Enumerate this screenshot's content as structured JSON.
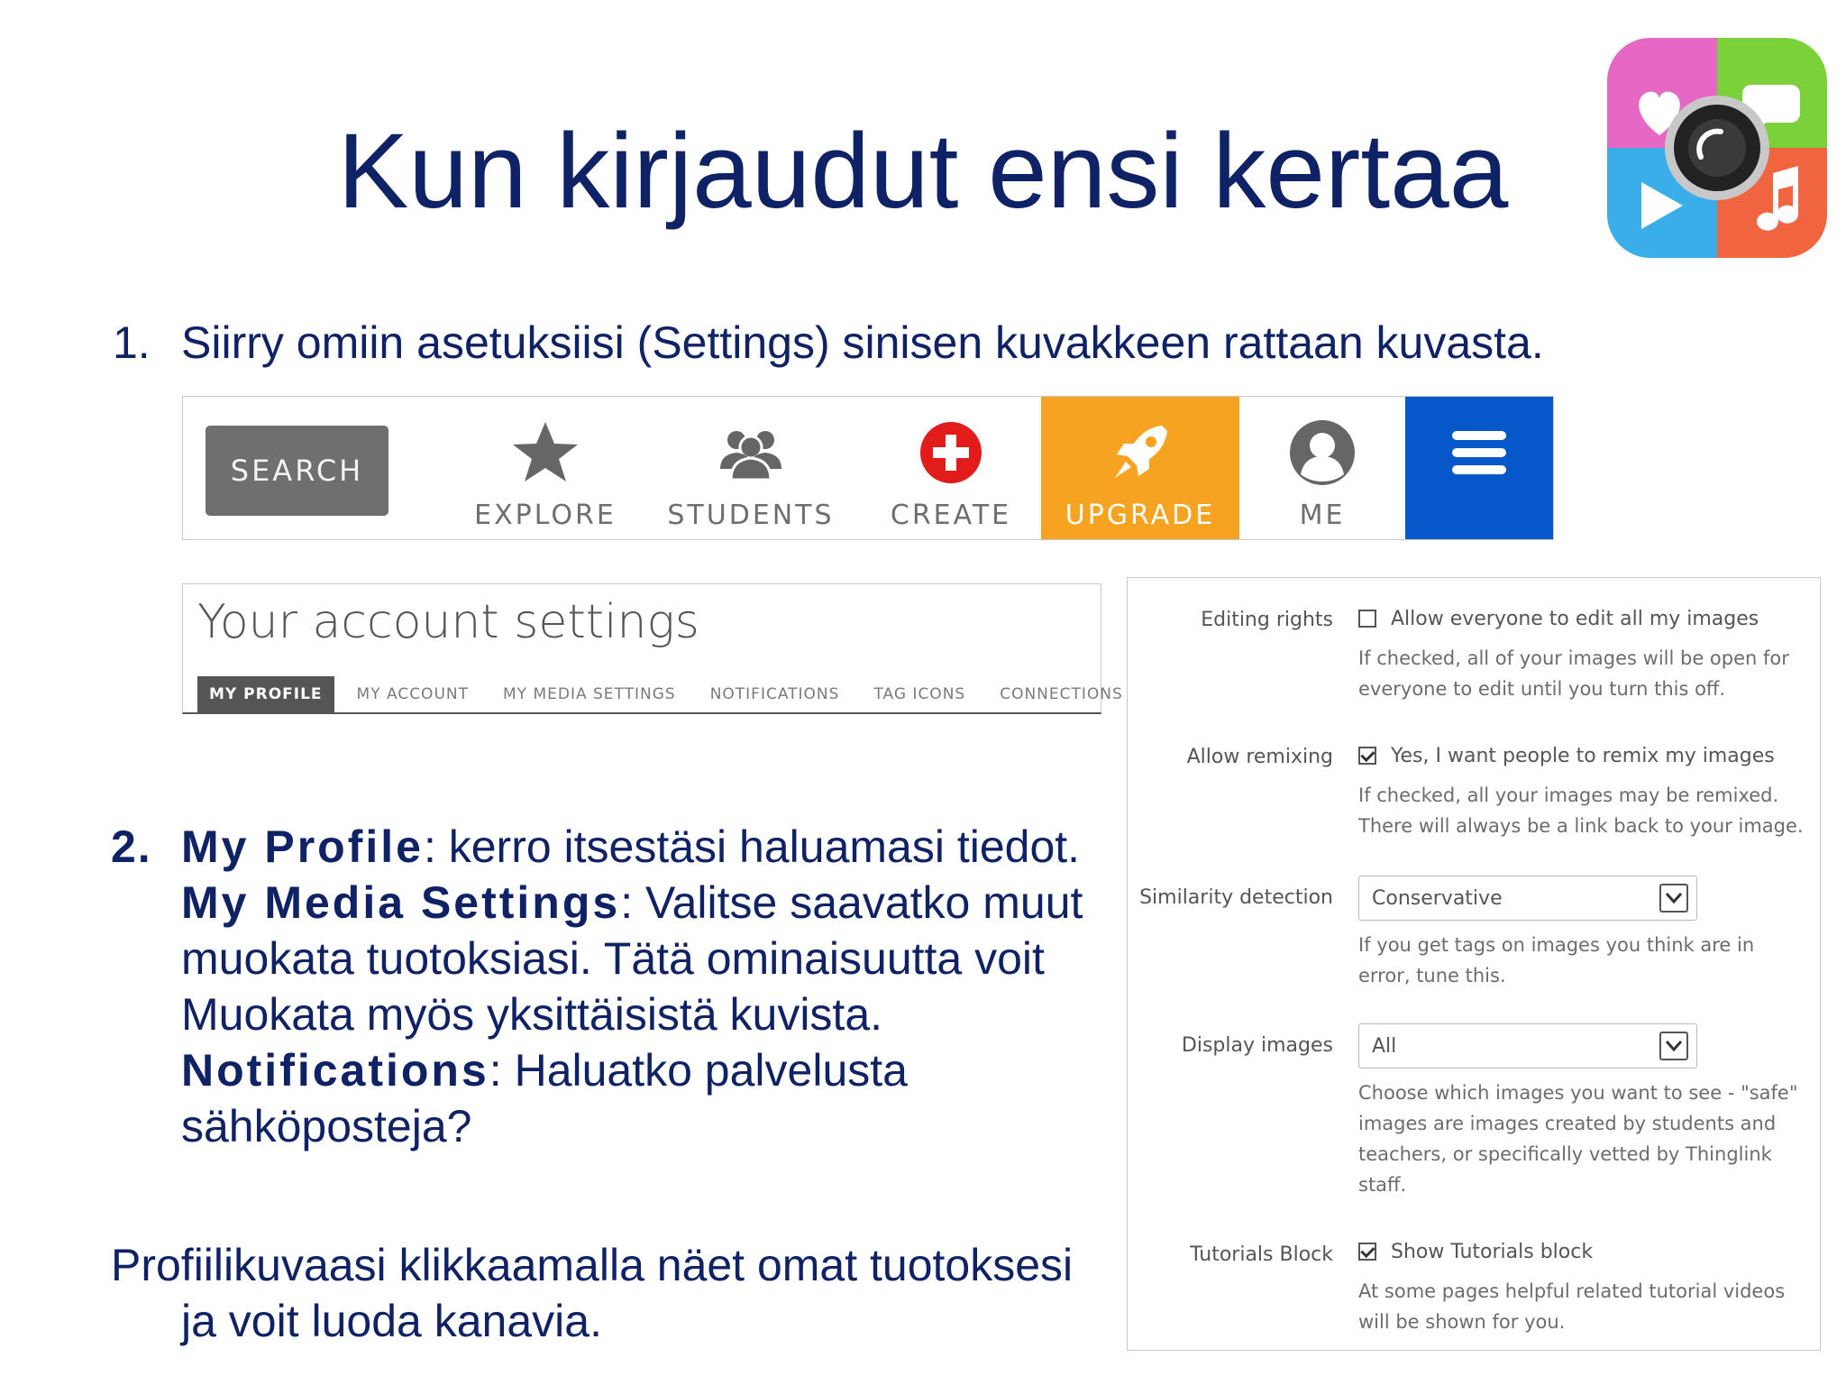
{
  "title": "Kun kirjaudut ensi kertaa",
  "step1": {
    "number": "1.",
    "text": "Siirry omiin asetuksiisi (Settings) sinisen kuvakkeen rattaan kuvasta."
  },
  "toolbar": {
    "search": "SEARCH",
    "explore": "EXPLORE",
    "students": "STUDENTS",
    "create": "CREATE",
    "upgrade": "UPGRADE",
    "me": "ME",
    "colors": {
      "upgrade_bg": "#f6a321",
      "menu_bg": "#0657c9",
      "create_red": "#e21b1b"
    }
  },
  "account": {
    "title": "Your account settings",
    "tabs": [
      "MY PROFILE",
      "MY ACCOUNT",
      "MY MEDIA SETTINGS",
      "NOTIFICATIONS",
      "TAG ICONS",
      "CONNECTIONS"
    ],
    "active_tab": "MY PROFILE"
  },
  "step2": {
    "number": "2.",
    "my_profile_bold": "My Profile",
    "my_profile_text": ": kerro itsestäsi haluamasi tiedot.",
    "media_bold": "My Media Settings",
    "media_text1": ": Valitse saavatko muut",
    "media_text2": "muokata tuotoksiasi. Tätä ominaisuutta voit",
    "media_text3": "Muokata myös yksittäisistä kuvista.",
    "notif_bold": "Notifications",
    "notif_text1": ": Haluatko palvelusta",
    "notif_text2": "sähköposteja?"
  },
  "profile_note": {
    "line1": "Profiilikuvaasi klikkaamalla näet omat tuotoksesi",
    "line2": "ja voit luoda kanavia."
  },
  "media_settings": {
    "editing": {
      "label": "Editing rights",
      "checkbox_label": "Allow everyone to edit all my images",
      "checked": false,
      "help1": "If checked, all of your images will be open for",
      "help2": "everyone to edit until you turn this off."
    },
    "remixing": {
      "label": "Allow remixing",
      "checkbox_label": "Yes, I want people to remix my images",
      "checked": true,
      "help1": "If checked, all your images may be remixed.",
      "help2": "There will always be a link back to your image."
    },
    "similarity": {
      "label": "Similarity detection",
      "value": "Conservative",
      "help1": "If you get tags on images you think are in",
      "help2": "error, tune this."
    },
    "display": {
      "label": "Display images",
      "value": "All",
      "help1": "Choose which images you want to see - \"safe\"",
      "help2": "images are images created by students and",
      "help3": "teachers, or specifically vetted by Thinglink",
      "help4": "staff."
    },
    "tutorials": {
      "label": "Tutorials Block",
      "checkbox_label": "Show Tutorials block",
      "checked": true,
      "help1": "At some pages helpful related tutorial videos",
      "help2": "will be shown for you."
    }
  }
}
